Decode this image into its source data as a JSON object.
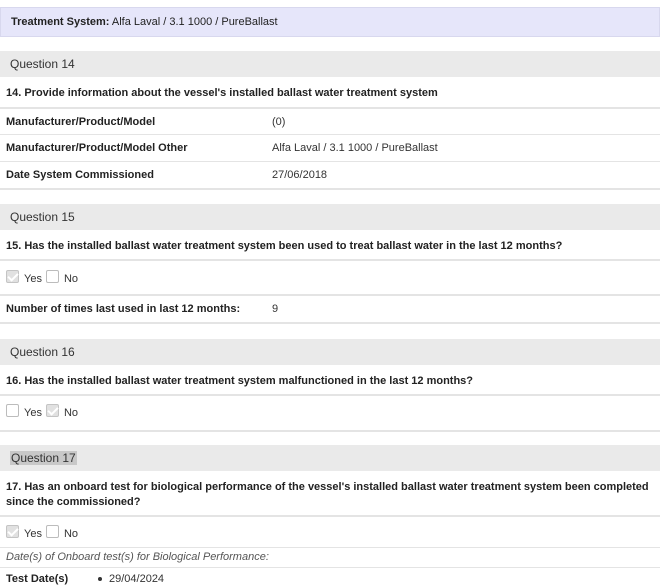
{
  "treatment_system": {
    "label": "Treatment System:",
    "value": "Alfa Laval / 3.1 1000 / PureBallast"
  },
  "q14": {
    "header": "Question 14",
    "text": "14. Provide information about the vessel's installed ballast water treatment system",
    "rows": [
      {
        "label": "Manufacturer/Product/Model",
        "value": "(0)"
      },
      {
        "label": "Manufacturer/Product/Model Other",
        "value": "Alfa Laval / 3.1 1000 / PureBallast"
      },
      {
        "label": "Date System Commissioned",
        "value": "27/06/2018"
      }
    ]
  },
  "q15": {
    "header": "Question 15",
    "text": "15. Has the installed ballast water treatment system been used to treat ballast water in the last 12 months?",
    "yes_label": "Yes",
    "no_label": "No",
    "yes_checked": true,
    "no_checked": false,
    "times_label": "Number of times last used in last 12 months:",
    "times_value": "9"
  },
  "q16": {
    "header": "Question 16",
    "text": "16. Has the installed ballast water treatment system malfunctioned in the last 12 months?",
    "yes_label": "Yes",
    "no_label": "No",
    "yes_checked": false,
    "no_checked": true
  },
  "q17": {
    "header": "Question 17",
    "text": "17. Has an onboard test for biological performance of the vessel's installed ballast water treatment system been completed since the commissioned?",
    "yes_label": "Yes",
    "no_label": "No",
    "yes_checked": true,
    "no_checked": false,
    "dates_note": "Date(s) of Onboard test(s) for Biological Performance:",
    "test_dates_label": "Test Date(s)",
    "test_dates": [
      "29/04/2024"
    ]
  }
}
